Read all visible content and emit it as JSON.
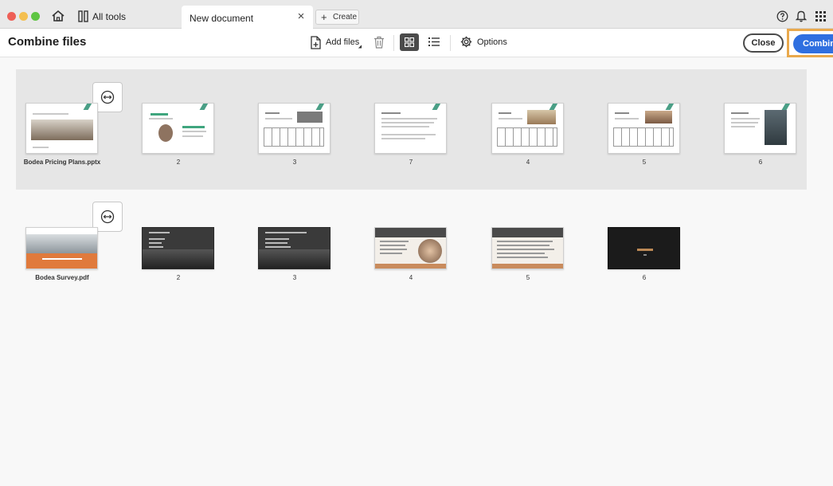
{
  "titlebar": {
    "all_tools_label": "All tools",
    "tab_title": "New document",
    "tab_close": "×",
    "create_label": "Create",
    "create_plus": "+"
  },
  "toolbar": {
    "title": "Combine files",
    "add_files_label": "Add files",
    "options_label": "Options",
    "close_label": "Close",
    "combine_label": "Combine"
  },
  "groups": [
    {
      "pages": [
        {
          "caption": "Bodea Pricing Plans.pptx"
        },
        {
          "caption": "2"
        },
        {
          "caption": "3"
        },
        {
          "caption": "7"
        },
        {
          "caption": "4"
        },
        {
          "caption": "5"
        },
        {
          "caption": "6"
        }
      ]
    },
    {
      "pages": [
        {
          "caption": "Bodea Survey.pdf"
        },
        {
          "caption": "2"
        },
        {
          "caption": "3"
        },
        {
          "caption": "4"
        },
        {
          "caption": "5"
        },
        {
          "caption": "6"
        }
      ]
    }
  ],
  "colors": {
    "accent_blue": "#2f6fe0",
    "highlight_orange": "#e9a94d",
    "slide_green": "#4a9f86"
  }
}
